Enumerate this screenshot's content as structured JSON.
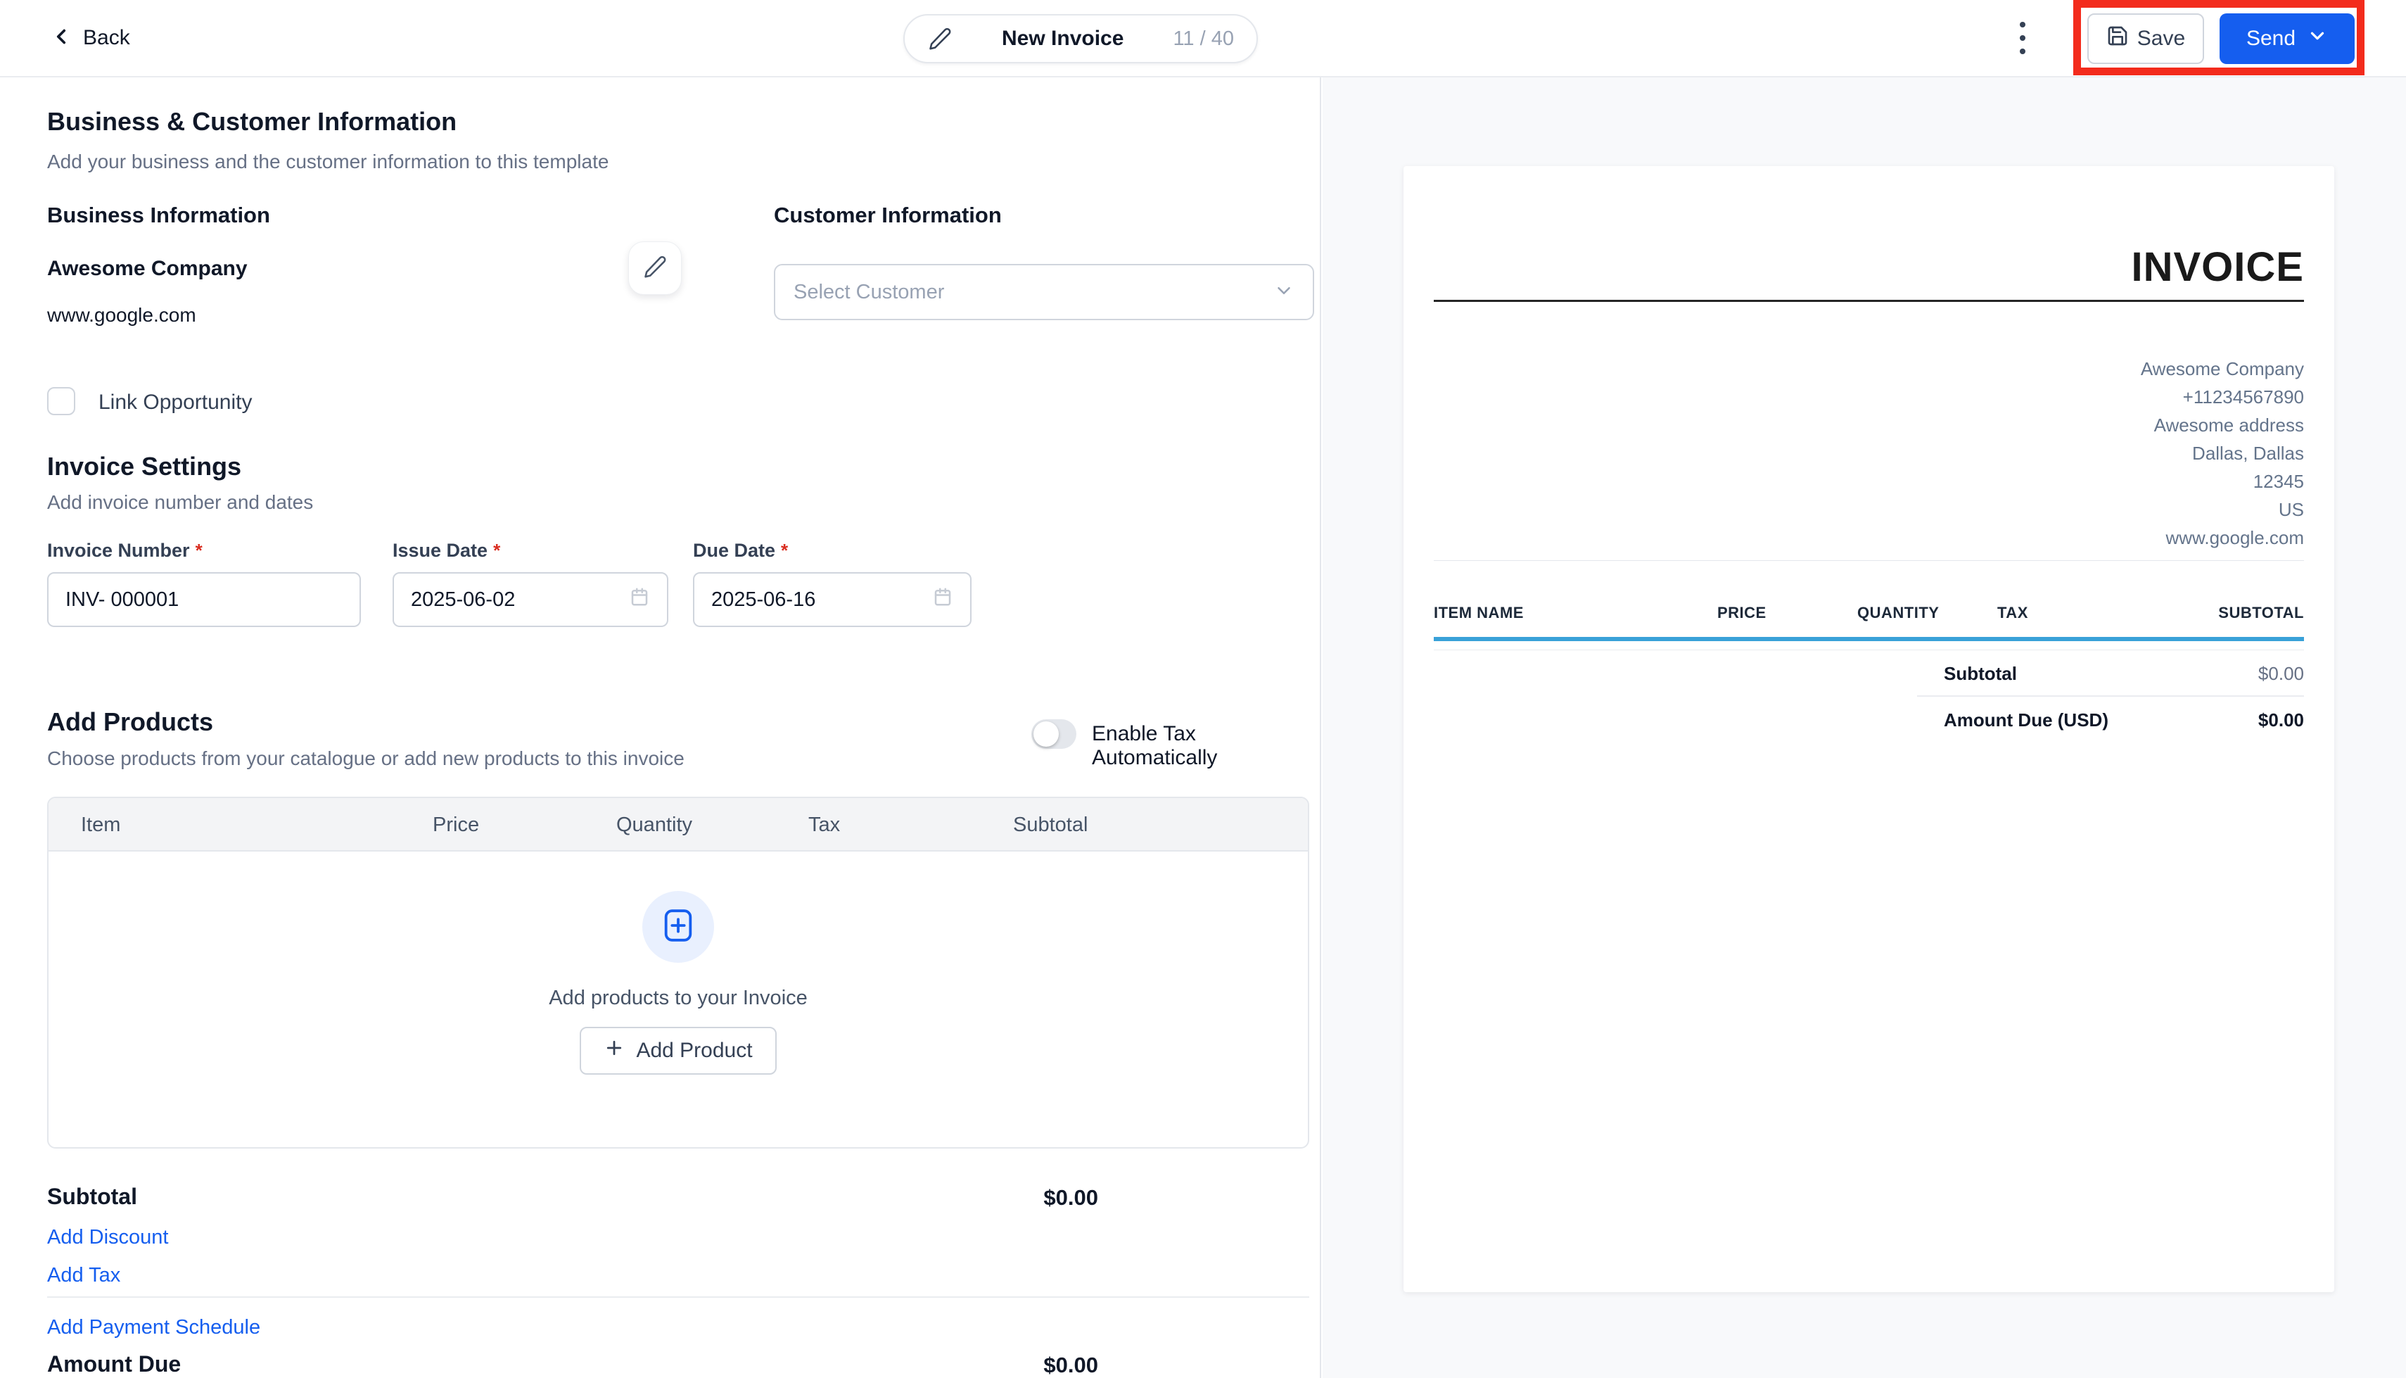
{
  "topbar": {
    "back_label": "Back",
    "title": "New Invoice",
    "title_counter": "11 / 40",
    "save_label": "Save",
    "send_label": "Send"
  },
  "business_customer": {
    "heading": "Business & Customer Information",
    "subtitle": "Add your business and the customer information to this template",
    "business_heading": "Business Information",
    "customer_heading": "Customer Information",
    "company_name": "Awesome Company",
    "company_website": "www.google.com",
    "customer_select_placeholder": "Select Customer",
    "link_opportunity_label": "Link Opportunity"
  },
  "invoice_settings": {
    "heading": "Invoice Settings",
    "subtitle": "Add invoice number and dates",
    "required_marker": "*",
    "invoice_number_label": "Invoice Number",
    "invoice_number_value": "INV- 000001",
    "issue_date_label": "Issue Date",
    "issue_date_value": "2025-06-02",
    "due_date_label": "Due Date",
    "due_date_value": "2025-06-16"
  },
  "products": {
    "heading": "Add Products",
    "subtitle": "Choose products from your catalogue or add new products to this invoice",
    "tax_toggle_label": "Enable Tax Automatically",
    "columns": [
      "Item",
      "Price",
      "Quantity",
      "Tax",
      "Subtotal"
    ],
    "empty_message": "Add products to your Invoice",
    "add_product_label": "Add Product"
  },
  "summary": {
    "subtotal_label": "Subtotal",
    "subtotal_value": "$0.00",
    "add_discount_label": "Add Discount",
    "add_tax_label": "Add Tax",
    "add_payment_schedule_label": "Add Payment Schedule",
    "amount_due_label": "Amount Due",
    "amount_due_value": "$0.00"
  },
  "preview": {
    "title": "INVOICE",
    "company_lines": [
      "Awesome Company",
      "+11234567890",
      "Awesome address",
      "Dallas, Dallas",
      "12345",
      "US",
      "www.google.com"
    ],
    "columns": [
      "ITEM NAME",
      "PRICE",
      "QUANTITY",
      "TAX",
      "SUBTOTAL"
    ],
    "subtotal_label": "Subtotal",
    "subtotal_value": "$0.00",
    "amount_due_label": "Amount Due (USD)",
    "amount_due_value": "$0.00"
  },
  "colors": {
    "accent_blue": "#155EEF",
    "highlight_red": "#F32B1C",
    "preview_rule_blue": "#39A1D8"
  }
}
